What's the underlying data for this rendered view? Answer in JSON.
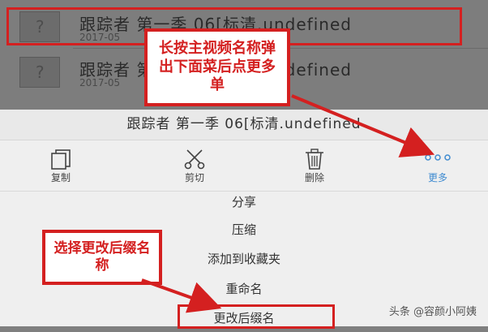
{
  "file_list": {
    "items": [
      {
        "name": "跟踪者 第一季 06[标清.undefined",
        "date": "2017-05",
        "thumb_glyph": "?"
      },
      {
        "name": "跟踪者 第一季 06[标清.undefined",
        "date": "2017-05",
        "thumb_glyph": "?"
      }
    ]
  },
  "sheet": {
    "title": "跟踪者 第一季 06[标清.undefined",
    "actions": [
      {
        "label": "复制",
        "icon": "copy-icon"
      },
      {
        "label": "剪切",
        "icon": "scissors-icon"
      },
      {
        "label": "删除",
        "icon": "trash-icon"
      },
      {
        "label": "更多",
        "icon": "more-dots-icon"
      }
    ],
    "menu": [
      "分享",
      "压缩",
      "添加到收藏夹",
      "重命名",
      "更改后缀名"
    ]
  },
  "annotations": {
    "callout_1": "长按主视频名称弹出下面菜后点更多单",
    "callout_2": "选择更改后缀名称"
  },
  "watermark": "头条 @容颜小阿姨",
  "colors": {
    "accent_red": "#d42020",
    "accent_blue": "#3f8bd0"
  }
}
